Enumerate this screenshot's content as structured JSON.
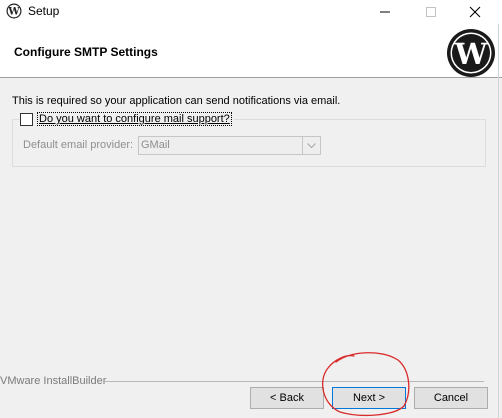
{
  "window": {
    "title": "Setup",
    "icon": "wordpress-icon",
    "controls": {
      "minimize": "minimize-icon",
      "maximize": "maximize-icon",
      "close": "close-icon"
    }
  },
  "header": {
    "title": "Configure SMTP Settings",
    "logo": "wordpress-logo"
  },
  "main": {
    "description": "This is required so your application can send notifications via email.",
    "mail_support": {
      "label": "Do you want to configure mail support?",
      "checked": false
    },
    "provider": {
      "label": "Default email provider:",
      "value": "GMail",
      "enabled": false
    }
  },
  "footer": {
    "brand": "VMware InstallBuilder",
    "back_label": "< Back",
    "next_label": "Next >",
    "cancel_label": "Cancel"
  },
  "colors": {
    "annotation": "#d92b2b",
    "focus": "#0078d7"
  }
}
